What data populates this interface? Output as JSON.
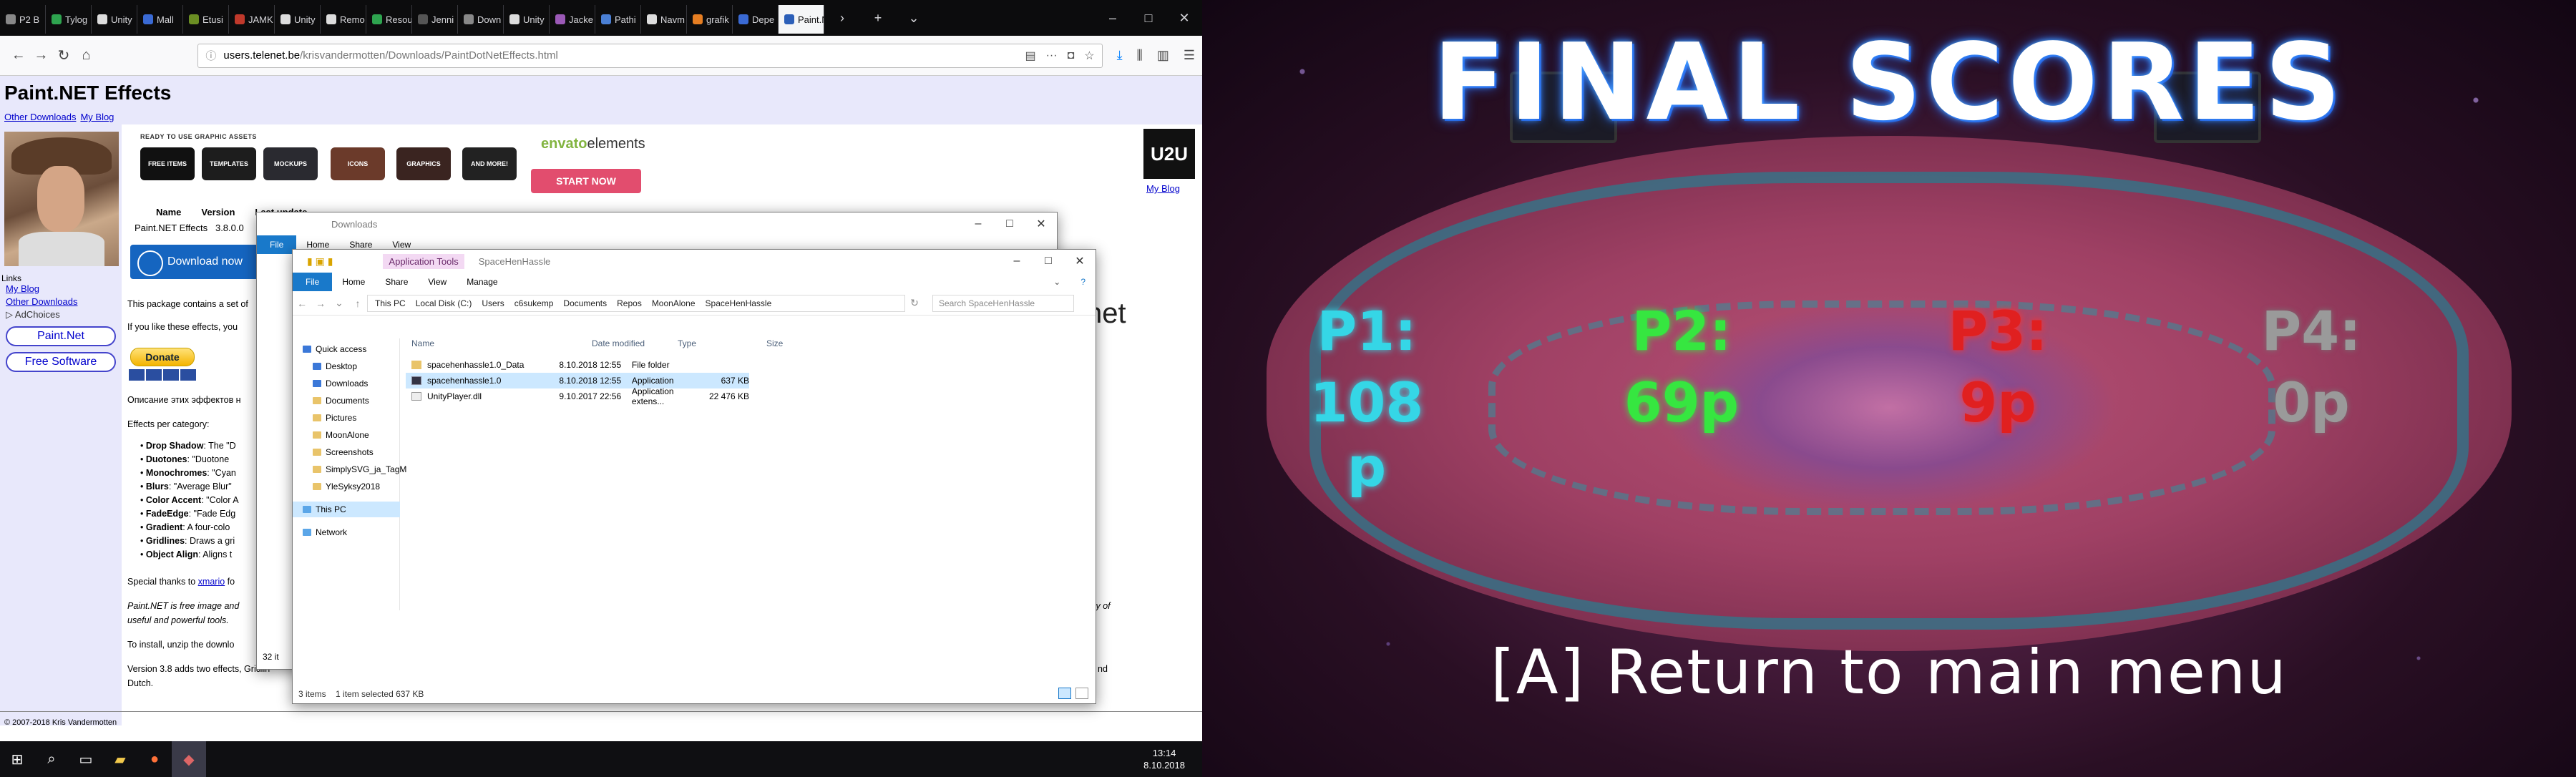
{
  "browser": {
    "tabs": [
      "P2 B",
      "Tylog",
      "Unity",
      "Mall",
      "Etusi",
      "JAMK",
      "Unity",
      "Remo",
      "Resou",
      "Jenni",
      "Down",
      "Unity",
      "Jacke",
      "Pathi",
      "Navm",
      "grafik",
      "Depe",
      "Paint.N"
    ],
    "url_host": "users.telenet.be",
    "url_path": "/krisvandermotten/Downloads/PaintDotNetEffects.html"
  },
  "page": {
    "title": "Paint.NET Effects",
    "header_links": [
      "Other Downloads",
      "My Blog"
    ],
    "links_label": "Links",
    "side_links": [
      "My Blog",
      "Other Downloads",
      "AdChoices"
    ],
    "side_buttons": [
      "Paint.Net",
      "Free Software"
    ],
    "ad_title": "READY TO USE GRAPHIC ASSETS",
    "ad_chips": [
      "FREE ITEMS",
      "TEMPLATES",
      "MOCKUPS",
      "ICONS",
      "GRAPHICS",
      "AND MORE!"
    ],
    "ad_brand": "envato",
    "ad_brand2": "elements",
    "ad_cta": "START NOW",
    "u2u": "U2U",
    "u2u_link": "My Blog",
    "table_headers": [
      "Name",
      "Version",
      "Last update"
    ],
    "table_row": [
      "Paint.NET Effects",
      "3.8.0.0"
    ],
    "download_label": "Download now",
    "line_package": "This package contains a set of",
    "line_like": "If you like these effects, you",
    "donate": "Donate",
    "ru_text": "Описание этих эффектов н",
    "effects_label": "Effects per category:",
    "effects": [
      {
        "name": "Drop Shadow",
        "desc": ": The \"D"
      },
      {
        "name": "Duotones",
        "desc": ": \"Duotone"
      },
      {
        "name": "Monochromes",
        "desc": ": \"Cyan"
      },
      {
        "name": "Blurs",
        "desc": ": \"Average Blur\""
      },
      {
        "name": "Color Accent",
        "desc": ": \"Color A"
      },
      {
        "name": "FadeEdge",
        "desc": ": \"Fade Edg"
      },
      {
        "name": "Gradient",
        "desc": ": A four-colo"
      },
      {
        "name": "Gridlines",
        "desc": ": Draws a gri"
      },
      {
        "name": "Object Align",
        "desc": ": Aligns t"
      }
    ],
    "thanks_pre": "Special thanks to ",
    "thanks_link": "xmario",
    "thanks_post": " fo",
    "paint_line1": "Paint.NET is free image and",
    "paint_line1_right": "ty of",
    "paint_line2": "useful and powerful tools.",
    "install_line": "To install, unzip the downlo",
    "version_line": "Version 3.8 adds two effects, Gridlin",
    "version_line_right": "nd",
    "version_line2": "Dutch.",
    "net_fragment": "net",
    "footer": "© 2007-2018 Kris Vandermotten"
  },
  "explorer_back": {
    "title": "Downloads",
    "ribbon": [
      "File",
      "Home",
      "Share",
      "View"
    ],
    "status": "32 it"
  },
  "explorer": {
    "title": "SpaceHenHassle",
    "context_tab": "Application Tools",
    "ribbon": [
      "File",
      "Home",
      "Share",
      "View",
      "Manage"
    ],
    "breadcrumb": [
      "This PC",
      "Local Disk (C:)",
      "Users",
      "c6sukemp",
      "Documents",
      "Repos",
      "MoonAlone",
      "SpaceHenHassle"
    ],
    "search_placeholder": "Search SpaceHenHassle",
    "nav": [
      "Quick access",
      "Desktop",
      "Downloads",
      "Documents",
      "Pictures",
      "MoonAlone",
      "Screenshots",
      "SimplySVG_ja_TagM",
      "YleSyksy2018",
      "This PC",
      "Network"
    ],
    "columns": [
      "Name",
      "Date modified",
      "Type",
      "Size"
    ],
    "files": [
      {
        "name": "spacehenhassle1.0_Data",
        "date": "8.10.2018 12:55",
        "type": "File folder",
        "size": ""
      },
      {
        "name": "spacehenhassle1.0",
        "date": "8.10.2018 12:55",
        "type": "Application",
        "size": "637 KB"
      },
      {
        "name": "UnityPlayer.dll",
        "date": "9.10.2017 22:56",
        "type": "Application extens...",
        "size": "22 476 KB"
      }
    ],
    "status_items": "3 items",
    "status_selected": "1 item selected  637 KB"
  },
  "taskbar": {
    "time": "13:14",
    "date": "8.10.2018"
  },
  "game": {
    "title": "FINAL SCORES",
    "players": [
      {
        "label": "P1:",
        "score": "108",
        "score2": "p",
        "color": "#35d6e6"
      },
      {
        "label": "P2:",
        "score": "69p",
        "color": "#36e640"
      },
      {
        "label": "P3:",
        "score": "9p",
        "color": "#e02020"
      },
      {
        "label": "P4:",
        "score": "0p",
        "color": "#9a9a9a"
      }
    ],
    "menu_prompt": "[A] Return to main menu"
  }
}
